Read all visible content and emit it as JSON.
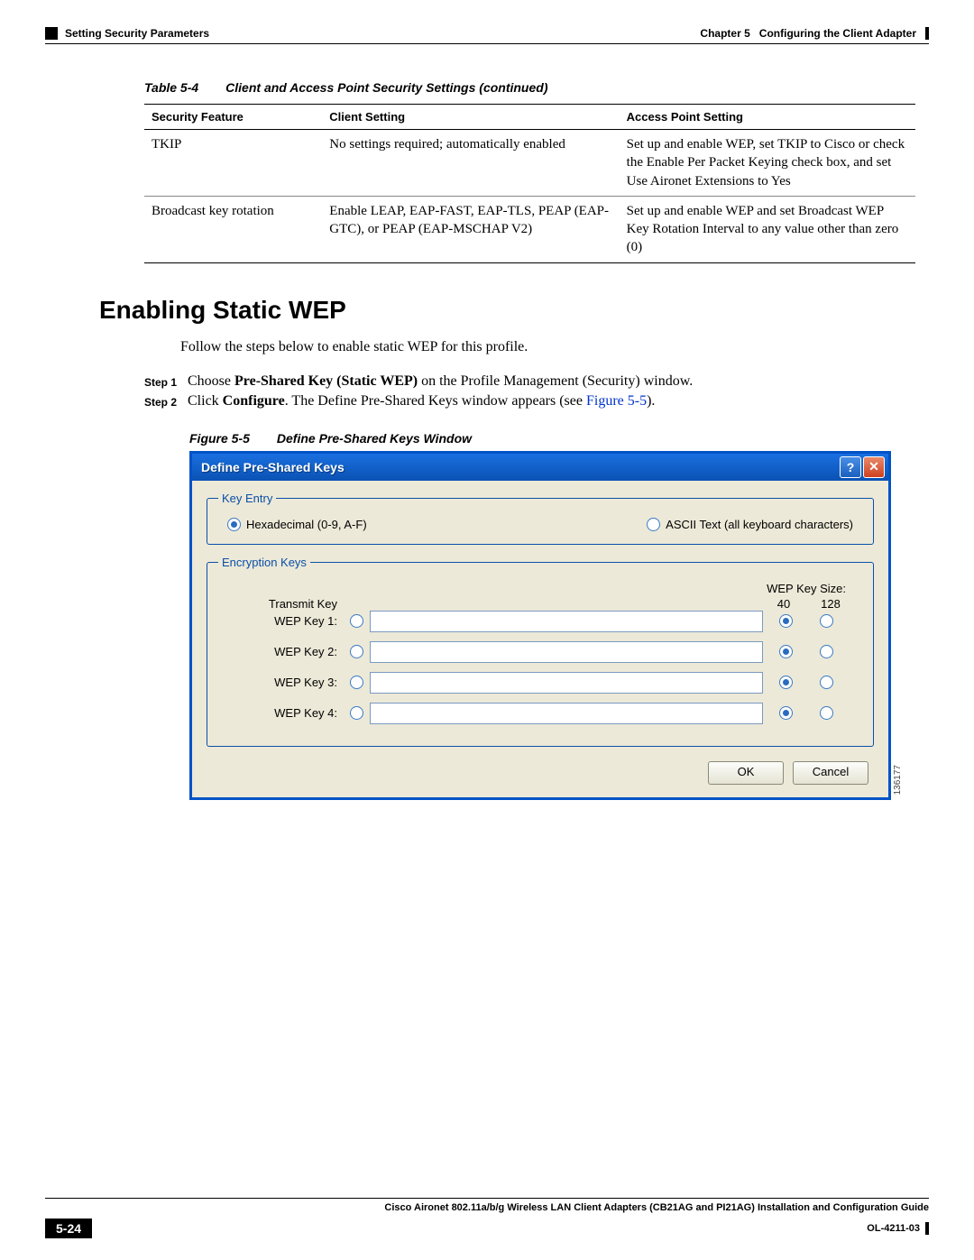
{
  "header": {
    "section_left": "Setting Security Parameters",
    "chapter_label": "Chapter 5",
    "chapter_title": "Configuring the Client Adapter"
  },
  "table": {
    "label": "Table 5-4",
    "title": "Client and Access Point Security Settings (continued)",
    "headers": {
      "c1": "Security Feature",
      "c2": "Client Setting",
      "c3": "Access Point Setting"
    },
    "rows": [
      {
        "c1": "TKIP",
        "c2": "No settings required; automatically enabled",
        "c3": "Set up and enable WEP, set TKIP to Cisco or check the Enable Per Packet Keying check box, and set Use Aironet Extensions to Yes"
      },
      {
        "c1": "Broadcast key rotation",
        "c2": "Enable LEAP, EAP-FAST, EAP-TLS, PEAP (EAP-GTC), or PEAP (EAP-MSCHAP V2)",
        "c3": "Set up and enable WEP and set Broadcast WEP Key Rotation Interval to any value other than zero (0)"
      }
    ]
  },
  "section_heading": "Enabling Static WEP",
  "intro": "Follow the steps below to enable static WEP for this profile.",
  "steps": [
    {
      "label": "Step 1",
      "pre": "Choose ",
      "bold": "Pre-Shared Key (Static WEP)",
      "post": " on the Profile Management (Security) window."
    },
    {
      "label": "Step 2",
      "pre": "Click ",
      "bold": "Configure",
      "post": ". The Define Pre-Shared Keys window appears (see ",
      "figref": "Figure 5-5",
      "post2": ")."
    }
  ],
  "figure": {
    "label": "Figure 5-5",
    "title": "Define Pre-Shared Keys Window"
  },
  "window": {
    "title": "Define Pre-Shared Keys",
    "key_entry": {
      "legend": "Key Entry",
      "opt_hex": "Hexadecimal (0-9, A-F)",
      "opt_ascii": "ASCII Text (all keyboard characters)"
    },
    "encryption": {
      "legend": "Encryption Keys",
      "transmit_label": "Transmit Key",
      "size_label": "WEP Key Size:",
      "size_40": "40",
      "size_128": "128",
      "rows": [
        {
          "label": "WEP Key 1:"
        },
        {
          "label": "WEP Key 2:"
        },
        {
          "label": "WEP Key 3:"
        },
        {
          "label": "WEP Key 4:"
        }
      ]
    },
    "buttons": {
      "ok": "OK",
      "cancel": "Cancel"
    },
    "image_id": "136177"
  },
  "footer": {
    "guide": "Cisco Aironet 802.11a/b/g Wireless LAN Client Adapters (CB21AG and PI21AG) Installation and Configuration Guide",
    "page": "5-24",
    "doc_id": "OL-4211-03"
  }
}
